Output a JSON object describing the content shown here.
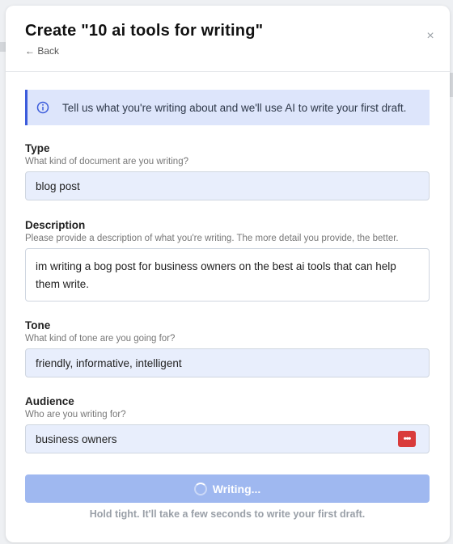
{
  "modal": {
    "title": "Create \"10 ai tools for writing\"",
    "back_label": "← Back",
    "close_icon": "×"
  },
  "info": {
    "icon": "info-icon",
    "text": "Tell us what you're writing about and we'll use AI to write your first draft."
  },
  "fields": {
    "type": {
      "label": "Type",
      "help": "What kind of document are you writing?",
      "value": "blog post"
    },
    "description": {
      "label": "Description",
      "help": "Please provide a description of what you're writing. The more detail you provide, the better.",
      "value": "im writing a bog post for business owners on the best ai tools that can help them write."
    },
    "tone": {
      "label": "Tone",
      "help": "What kind of tone are you going for?",
      "value": "friendly, informative, intelligent"
    },
    "audience": {
      "label": "Audience",
      "help": "Who are you writing for?",
      "value": "business owners",
      "trailing_icon": "password-manager-icon"
    }
  },
  "submit": {
    "label": "Writing...",
    "icon": "spinner-icon"
  },
  "hint": "Hold tight. It'll take a few seconds to write your first draft.",
  "colors": {
    "accent": "#3b5bdb",
    "info_bg": "#dde5fb",
    "input_bg": "#e8eefc",
    "button_bg": "#9fb8f0",
    "pw_icon": "#d93b3b"
  }
}
